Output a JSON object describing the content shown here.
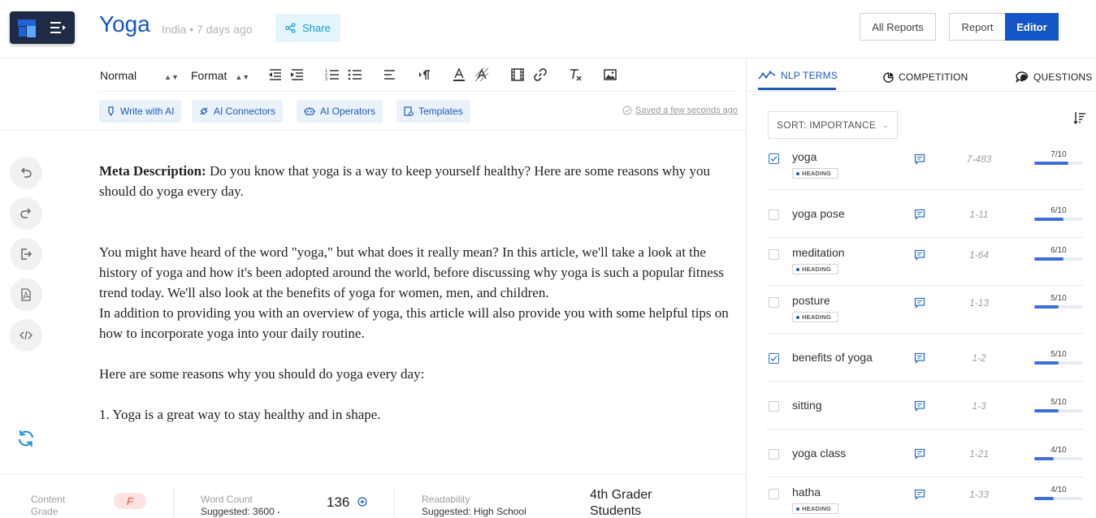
{
  "header": {
    "title": "Yoga",
    "meta": "India • 7 days ago",
    "share_label": "Share",
    "all_reports_label": "All Reports",
    "report_label": "Report",
    "editor_label": "Editor"
  },
  "toolbar": {
    "paragraph_style": "Normal",
    "format_label": "Format",
    "ai_buttons": [
      "Write with AI",
      "AI Connectors",
      "AI Operators",
      "Templates"
    ],
    "saved_status": "Saved a few seconds ago"
  },
  "content": {
    "meta_label": "Meta Description:",
    "meta_text": " Do you know that yoga is a way to keep yourself healthy? Here are some reasons why you should do yoga every day.",
    "para1": "You might have heard of the word \"yoga,\" but what does it really mean? In this article, we'll take a look at the history of yoga and how it's been adopted around the world, before discussing why yoga is such a popular fitness trend today. We'll also look at the benefits of yoga for women, men, and children.",
    "para2": "In addition to providing you with an overview of yoga, this article will also provide you with some helpful tips on how to incorporate yoga into your daily routine.",
    "para3": "Here are some reasons why you should do yoga every day:",
    "para4": "1. Yoga is a great way to stay healthy and in shape."
  },
  "bottombar": {
    "content_grade_label": "Content Grade",
    "content_grade_value": "F",
    "word_count_label": "Word Count",
    "word_count_suggested": "Suggested: 3600 -",
    "word_count_value": "136",
    "readability_label": "Readability",
    "readability_suggested": "Suggested: High School",
    "readability_value": "4th Grader Students"
  },
  "panel": {
    "tabs": [
      "NLP TERMS",
      "COMPETITION",
      "QUESTIONS"
    ],
    "sort_label": "SORT: IMPORTANCE",
    "heading_badge": "HEADING",
    "terms": [
      {
        "name": "yoga",
        "checked": true,
        "heading": true,
        "range": "7-483",
        "score": "7/10",
        "level": 0.7
      },
      {
        "name": "yoga pose",
        "checked": false,
        "heading": false,
        "range": "1-11",
        "score": "6/10",
        "level": 0.6
      },
      {
        "name": "meditation",
        "checked": false,
        "heading": true,
        "range": "1-64",
        "score": "6/10",
        "level": 0.6
      },
      {
        "name": "posture",
        "checked": false,
        "heading": true,
        "range": "1-13",
        "score": "5/10",
        "level": 0.5
      },
      {
        "name": "benefits of yoga",
        "checked": true,
        "heading": false,
        "range": "1-2",
        "score": "5/10",
        "level": 0.5
      },
      {
        "name": "sitting",
        "checked": false,
        "heading": false,
        "range": "1-3",
        "score": "5/10",
        "level": 0.5
      },
      {
        "name": "yoga class",
        "checked": false,
        "heading": false,
        "range": "1-21",
        "score": "4/10",
        "level": 0.4
      },
      {
        "name": "hatha",
        "checked": false,
        "heading": true,
        "range": "1-33",
        "score": "4/10",
        "level": 0.4
      }
    ]
  },
  "colors": {
    "brand_blue": "#1456c8",
    "share_bg": "#e4f4fb",
    "grade_f": "#e94d3c",
    "bar_fill": "#3d6fd9"
  }
}
